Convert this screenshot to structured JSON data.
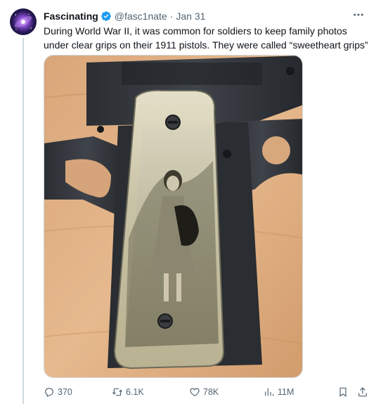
{
  "author": {
    "name": "Fascinating",
    "handle": "@fasc1nate",
    "separator": "·",
    "date": "Jan 31",
    "verified": true,
    "avatar_icon": "galaxy-avatar",
    "verified_color": "#1d9bf0"
  },
  "tweet": {
    "text": "During World War II, it was common for soldiers to keep family photos\nunder clear grips on their 1911 pistols. They were called “sweetheart grips”"
  },
  "media": {
    "type": "photo",
    "subject_icon": "pistol-photo"
  },
  "actions": {
    "reply": {
      "icon": "reply-icon",
      "count": "370"
    },
    "retweet": {
      "icon": "retweet-icon",
      "count": "6.1K"
    },
    "like": {
      "icon": "heart-icon",
      "count": "78K"
    },
    "views": {
      "icon": "views-icon",
      "count": "11M"
    },
    "bookmark": {
      "icon": "bookmark-icon"
    },
    "share": {
      "icon": "share-icon"
    }
  },
  "colors": {
    "text": "#0f1419",
    "secondary": "#536471",
    "border": "#cfd9de",
    "accent": "#1d9bf0"
  }
}
